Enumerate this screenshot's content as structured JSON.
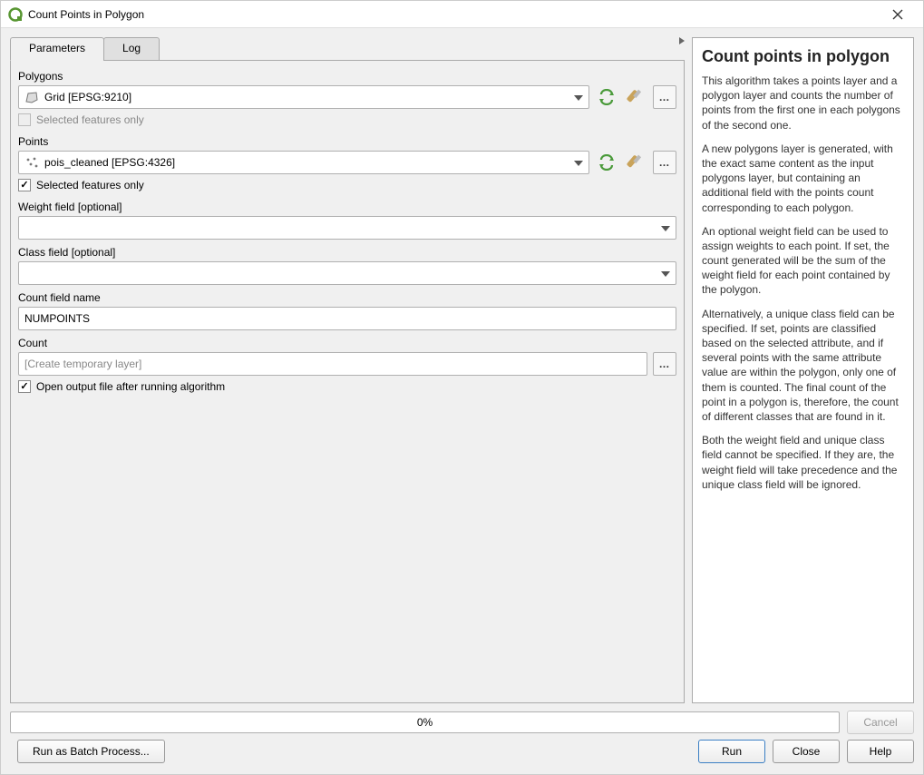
{
  "window": {
    "title": "Count Points in Polygon"
  },
  "tabs": {
    "parameters": "Parameters",
    "log": "Log"
  },
  "labels": {
    "polygons": "Polygons",
    "points": "Points",
    "selected_only": "Selected features only",
    "weight_field": "Weight field [optional]",
    "class_field": "Class field [optional]",
    "count_field_name": "Count field name",
    "count": "Count",
    "open_output": "Open output file after running algorithm"
  },
  "values": {
    "polygons_layer": "Grid [EPSG:9210]",
    "points_layer": "pois_cleaned [EPSG:4326]",
    "polygons_selected_only": false,
    "points_selected_only": true,
    "weight_field": "",
    "class_field": "",
    "count_field_name": "NUMPOINTS",
    "count_output_placeholder": "[Create temporary layer]",
    "open_output": true
  },
  "progress": {
    "text": "0%"
  },
  "buttons": {
    "cancel": "Cancel",
    "run_batch": "Run as Batch Process...",
    "run": "Run",
    "close": "Close",
    "help": "Help"
  },
  "help": {
    "title": "Count points in polygon",
    "p1": "This algorithm takes a points layer and a polygon layer and counts the number of points from the first one in each polygons of the second one.",
    "p2": "A new polygons layer is generated, with the exact same content as the input polygons layer, but containing an additional field with the points count corresponding to each polygon.",
    "p3": "An optional weight field can be used to assign weights to each point. If set, the count generated will be the sum of the weight field for each point contained by the polygon.",
    "p4": "Alternatively, a unique class field can be specified. If set, points are classified based on the selected attribute, and if several points with the same attribute value are within the polygon, only one of them is counted. The final count of the point in a polygon is, therefore, the count of different classes that are found in it.",
    "p5": "Both the weight field and unique class field cannot be specified. If they are, the weight field will take precedence and the unique class field will be ignored."
  }
}
